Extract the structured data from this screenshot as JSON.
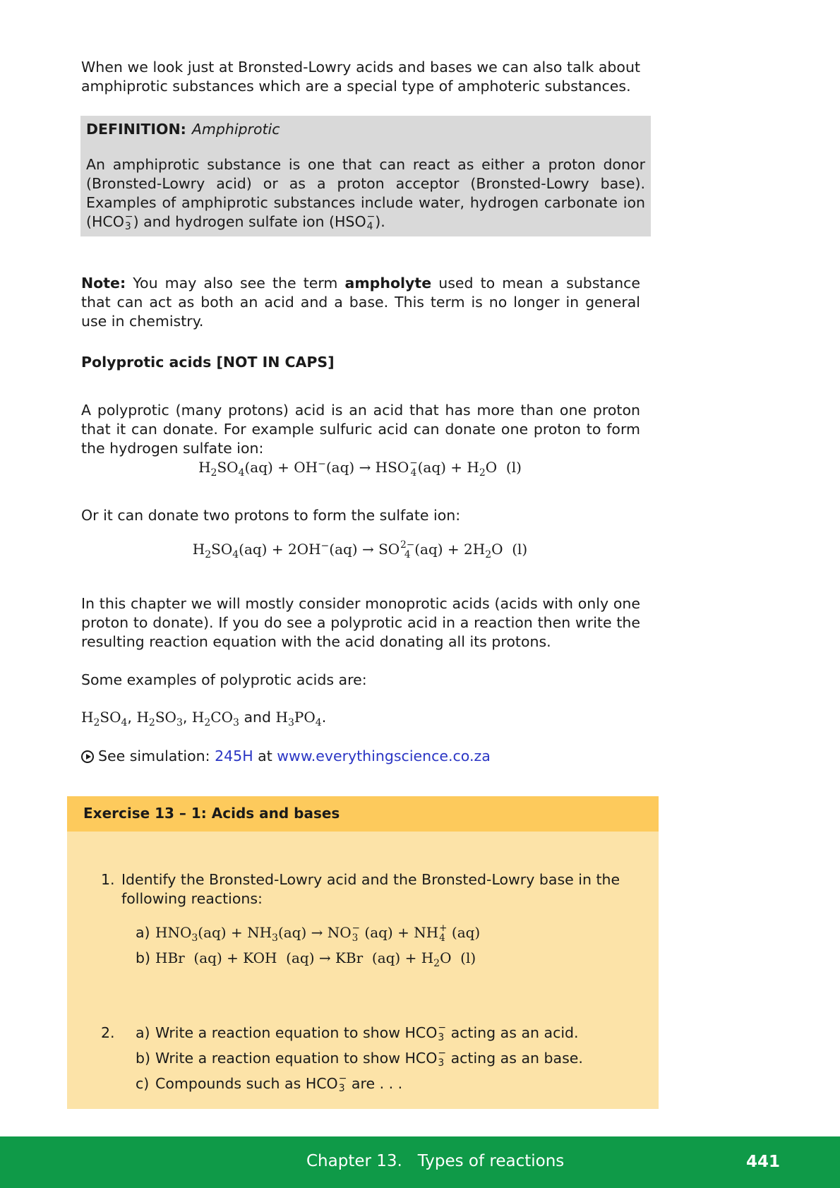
{
  "intro": "When we look just at Bronsted-Lowry acids and bases we can also talk about amphiprotic substances which are a special type of amphoteric substances.",
  "definition": {
    "label": "DEFINITION:",
    "term": "Amphiprotic",
    "body_part1": "An amphiprotic substance is one that can react as either a proton donor (Bronsted-Lowry acid) or as a proton acceptor (Bronsted-Lowry base). Examples of amphiprotic substances include water, hydrogen carbonate ion (",
    "body_part2": ") and hydrogen sulfate ion (",
    "body_part3": ")."
  },
  "note": {
    "label": "Note:",
    "text1": "You may also see the term",
    "term": "ampholyte",
    "text2": "used to mean a substance that can act as both an acid and a base. This term is no longer in general use in chemistry."
  },
  "polyprotic": {
    "heading": "Polyprotic acids [NOT IN CAPS]",
    "intro": "A polyprotic (many protons) acid is an acid that has more than one proton that it can donate. For example sulfuric acid can donate one proton to form the hydrogen sulfate ion:",
    "or_text": "Or it can donate two protons to form the sulfate ion:",
    "chapter_text": "In this chapter we will mostly consider monoprotic acids (acids with only one proton to donate). If you do see a polyprotic acid in a reaction then write the resulting reaction equation with the acid donating all its protons.",
    "examples_intro": "Some examples of polyprotic acids are:",
    "and_word": "and"
  },
  "simulation": {
    "label": "See simulation:",
    "code": "245H",
    "at": "at",
    "url": "www.everythingscience.co.za"
  },
  "exercise": {
    "title": "Exercise 13 – 1: Acids and bases",
    "q1_num": "1.",
    "q1_text": "Identify the Bronsted-Lowry acid and the Bronsted-Lowry base in the following reactions:",
    "q1a_label": "a)",
    "q1b_label": "b)",
    "q2_num": "2.",
    "q2a_label": "a)",
    "q2a_text1": "Write a reaction equation to show",
    "q2a_text2": "acting as an acid.",
    "q2b_label": "b)",
    "q2b_text1": "Write a reaction equation to show",
    "q2b_text2": "acting as an base.",
    "q2c_label": "c)",
    "q2c_text1": "Compounds such as",
    "q2c_text2": "are . . ."
  },
  "footer": {
    "chapter": "Chapter 13.   Types of reactions",
    "page": "441"
  },
  "colors": {
    "definition_bg": "#d9d9d9",
    "exercise_header": "#fdca5c",
    "exercise_body": "#fce3a8",
    "footer_bg": "#0f9a48",
    "link": "#2a35c4"
  }
}
